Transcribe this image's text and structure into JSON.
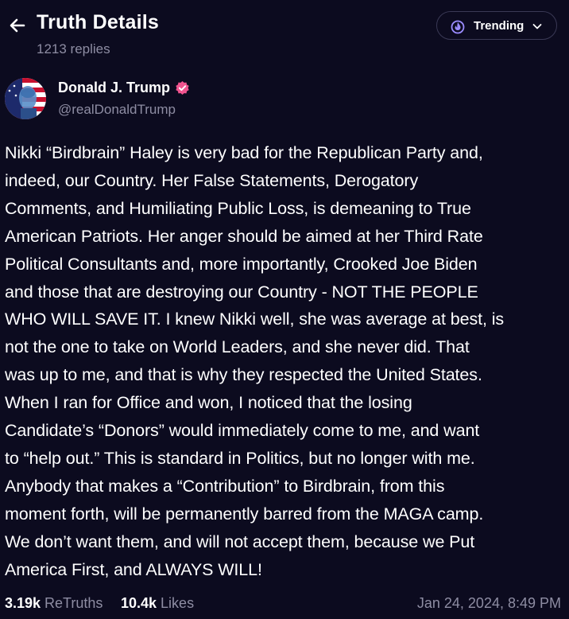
{
  "header": {
    "title": "Truth Details",
    "reply_count": "1213 replies",
    "trending_label": "Trending"
  },
  "author": {
    "name": "Donald J. Trump",
    "handle": "@realDonaldTrump",
    "verified": true
  },
  "post": {
    "lines": [
      "Nikki “Birdbrain” Haley is very bad for the Republican Party and,",
      "indeed, our Country. Her False Statements, Derogatory",
      "Comments, and Humiliating Public Loss, is demeaning to True",
      "American Patriots. Her anger should be aimed at her Third Rate",
      "Political Consultants and, more importantly, Crooked Joe Biden",
      "and those that are destroying our Country - NOT THE PEOPLE",
      "WHO WILL SAVE IT. I knew Nikki well, she was average at best, is",
      "not the one to take on World Leaders, and she never did. That",
      "was up to me, and that is why they respected the United States.",
      "When I ran for Office and won, I noticed that the losing",
      "Candidate’s “Donors” would immediately come to me, and want",
      "to “help out.” This is standard in Politics, but no longer with me.",
      "Anybody that makes a “Contribution” to Birdbrain, from this",
      "moment forth, will be permanently barred from the MAGA camp.",
      "We don’t want them, and will not accept them, because we Put",
      "America First, and ALWAYS WILL!"
    ]
  },
  "stats": {
    "retruths_count": "3.19k",
    "retruths_label": "ReTruths",
    "likes_count": "10.4k",
    "likes_label": "Likes",
    "timestamp": "Jan 24, 2024, 8:49 PM"
  },
  "icons": {
    "back": "arrow-left-icon",
    "trending": "flame-icon",
    "dropdown": "chevron-down-icon",
    "verified": "verified-badge-icon"
  },
  "colors": {
    "background": "#0c0b1f",
    "muted_text": "#8e8da3",
    "verified_badge": "#f0548f",
    "accent_icon": "#9b8cff"
  }
}
